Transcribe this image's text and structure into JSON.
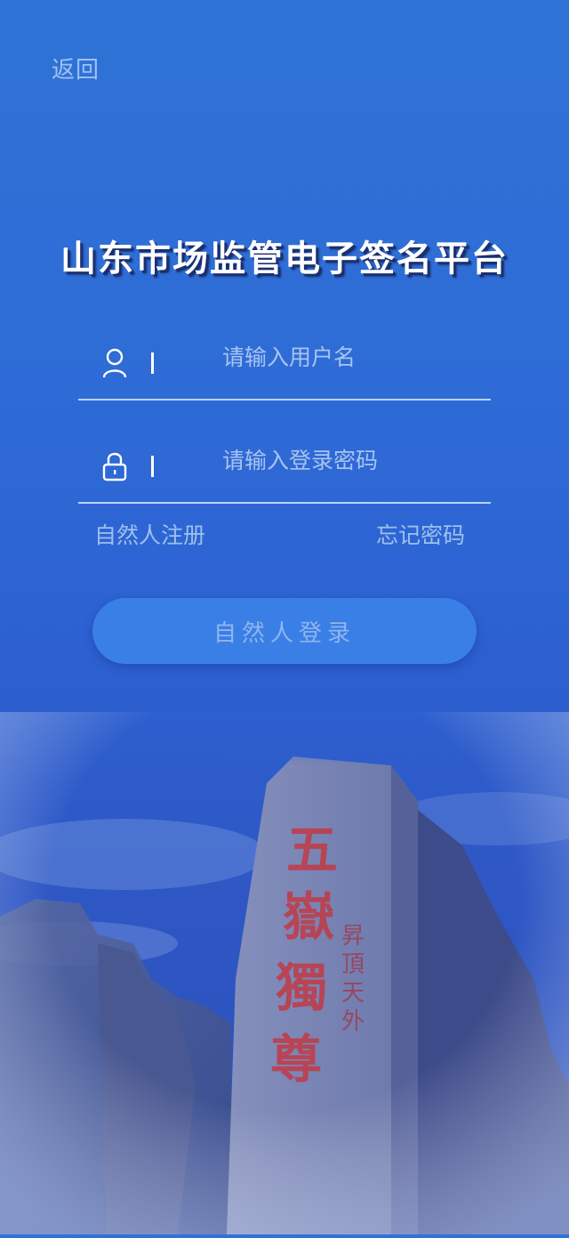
{
  "header": {
    "back_label": "返回"
  },
  "title": "山东市场监管电子签名平台",
  "form": {
    "username": {
      "placeholder": "请输入用户名",
      "value": "",
      "icon": "user-icon"
    },
    "password": {
      "placeholder": "请输入登录密码",
      "value": "",
      "icon": "lock-icon"
    },
    "register_label": "自然人注册",
    "forgot_label": "忘记密码",
    "login_label": "自然人登录"
  },
  "colors": {
    "background_top": "#2f73d6",
    "background_bottom": "#2a4fb7",
    "button": "#3a7fe6",
    "link_text": "#9ec0ee",
    "stone_inscription": "#c23a45"
  },
  "background_image": {
    "inscription_main": "五嶽獨尊",
    "inscription_side": "昇頂天外"
  }
}
